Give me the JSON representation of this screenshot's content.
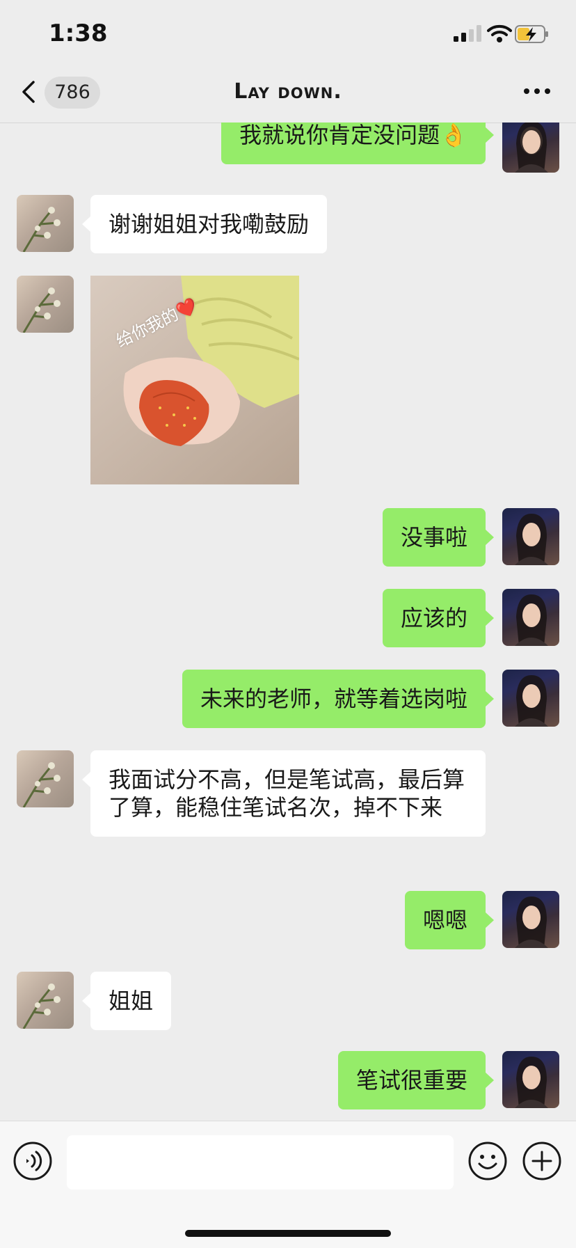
{
  "status_bar": {
    "time": "1:38"
  },
  "header": {
    "title": "Lay down.",
    "unread_count": "786"
  },
  "messages": [
    {
      "sender": "me",
      "text": "我就说你肯定没问题👌"
    },
    {
      "sender": "other",
      "text": "谢谢姐姐对我嘞鼓励"
    },
    {
      "sender": "other",
      "type": "image",
      "caption": "给你我的❤️"
    },
    {
      "sender": "me",
      "text": "没事啦"
    },
    {
      "sender": "me",
      "text": "应该的"
    },
    {
      "sender": "me",
      "text": "未来的老师，就等着选岗啦"
    },
    {
      "sender": "other",
      "text": "我面试分不高，但是笔试高，最后算了算，能稳住笔试名次，掉不下来"
    },
    {
      "sender": "me",
      "text": "嗯嗯"
    },
    {
      "sender": "other",
      "text": "姐姐"
    },
    {
      "sender": "me",
      "text": "笔试很重要"
    }
  ],
  "input": {
    "placeholder": ""
  },
  "colors": {
    "my_bubble": "#95ec69",
    "their_bubble": "#ffffff",
    "background": "#ededed"
  }
}
